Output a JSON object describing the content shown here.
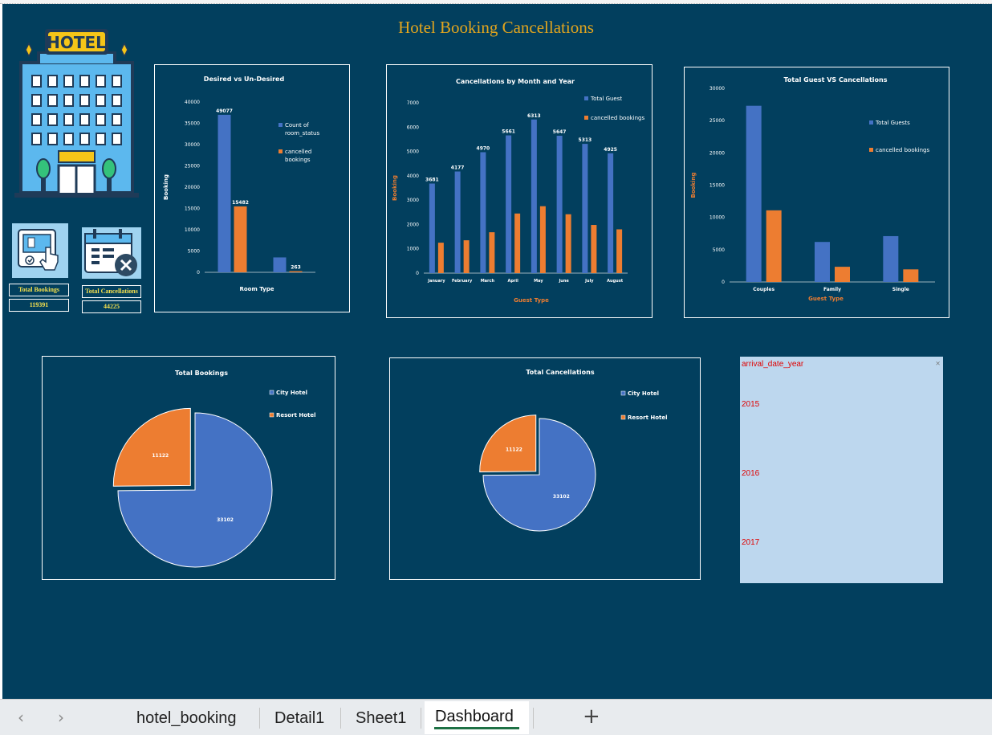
{
  "dashboard": {
    "title": "Hotel Booking Cancellations",
    "kpis": [
      {
        "label": "Total Bookings",
        "value": "119391"
      },
      {
        "label": "Total Cancellations",
        "value": "44225"
      }
    ],
    "hotel_sign": "HOTEL"
  },
  "colors": {
    "background": "#023f5e",
    "blue_series": "#4472c4",
    "orange_series": "#ed7d31",
    "title_gold": "#e2a51e",
    "slicer_bg": "#bdd7ee",
    "slicer_text": "#e00000",
    "active_tab_underline": "#1e7145"
  },
  "slicer": {
    "header": "arrival_date_year",
    "items": [
      "2015",
      "2016",
      "2017"
    ]
  },
  "tabs": {
    "items": [
      "hotel_booking",
      "Detail1",
      "Sheet1",
      "Dashboard"
    ],
    "active": "Dashboard",
    "add_label": "+"
  },
  "chart_data": [
    {
      "type": "bar",
      "title": "Desired vs Un-Desired",
      "xlabel": "Room Type",
      "ylabel": "Booking",
      "ylim": [
        0,
        40000
      ],
      "yticks": [
        0,
        5000,
        10000,
        15000,
        20000,
        25000,
        30000,
        35000,
        40000
      ],
      "series": [
        {
          "name": "Count of room_status",
          "values": [
            37000,
            3500
          ],
          "labels": [
            "49077",
            ""
          ]
        },
        {
          "name": "cancelled bookings",
          "values": [
            15482,
            263
          ],
          "labels": [
            "15482",
            "263"
          ]
        }
      ],
      "legend_position": "right",
      "grid": false
    },
    {
      "type": "bar",
      "title": "Cancellations by Month and Year",
      "xlabel": "Guest Type",
      "ylabel": "Booking",
      "ylim": [
        0,
        7000
      ],
      "yticks": [
        0,
        1000,
        2000,
        3000,
        4000,
        5000,
        6000,
        7000
      ],
      "categories": [
        "January",
        "February",
        "March",
        "April",
        "May",
        "June",
        "July",
        "August"
      ],
      "series": [
        {
          "name": "Total Guest",
          "values": [
            3681,
            4177,
            4970,
            5661,
            6313,
            5647,
            5313,
            4925
          ]
        },
        {
          "name": "cancelled bookings",
          "values": [
            1250,
            1350,
            1680,
            2450,
            2750,
            2420,
            1980,
            1800
          ]
        }
      ],
      "legend_position": "top-right",
      "grid": false
    },
    {
      "type": "bar",
      "title": "Total  Guest VS Cancellations",
      "xlabel": "Guest Type",
      "ylabel": "Booking",
      "ylim": [
        0,
        30000
      ],
      "yticks": [
        0,
        5000,
        10000,
        15000,
        20000,
        25000,
        30000
      ],
      "categories": [
        "Couples",
        "Family",
        "Single"
      ],
      "series": [
        {
          "name": "Total Guests",
          "values": [
            27300,
            6200,
            7100
          ]
        },
        {
          "name": "cancelled bookings",
          "values": [
            11100,
            2350,
            1950
          ]
        }
      ],
      "legend_position": "right",
      "grid": false
    },
    {
      "type": "pie",
      "title": "Total Bookings",
      "categories": [
        "City Hotel",
        "Resort Hotel"
      ],
      "values": [
        33102,
        11122
      ],
      "legend_position": "top-right"
    },
    {
      "type": "pie",
      "title": "Total Cancellations",
      "categories": [
        "City Hotel",
        "Resort Hotel"
      ],
      "values": [
        33102,
        11122
      ],
      "legend_position": "top-right"
    }
  ]
}
